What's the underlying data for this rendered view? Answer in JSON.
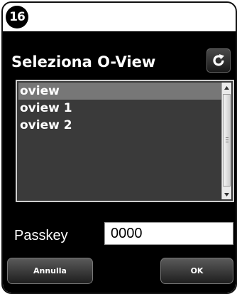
{
  "step": {
    "number": "16"
  },
  "dialog": {
    "title": "Seleziona O-View",
    "refresh_icon": "refresh-icon",
    "list": {
      "items": [
        {
          "label": "oview",
          "selected": true
        },
        {
          "label": "oview 1",
          "selected": false
        },
        {
          "label": "oview 2",
          "selected": false
        }
      ]
    },
    "passkey": {
      "label": "Passkey",
      "value": "0000"
    },
    "buttons": {
      "cancel": "Annulla",
      "ok": "OK"
    }
  },
  "colors": {
    "screen_bg": "#000000",
    "list_bg": "#3a3a3a",
    "selected_row": "#777777",
    "text": "#ffffff"
  }
}
